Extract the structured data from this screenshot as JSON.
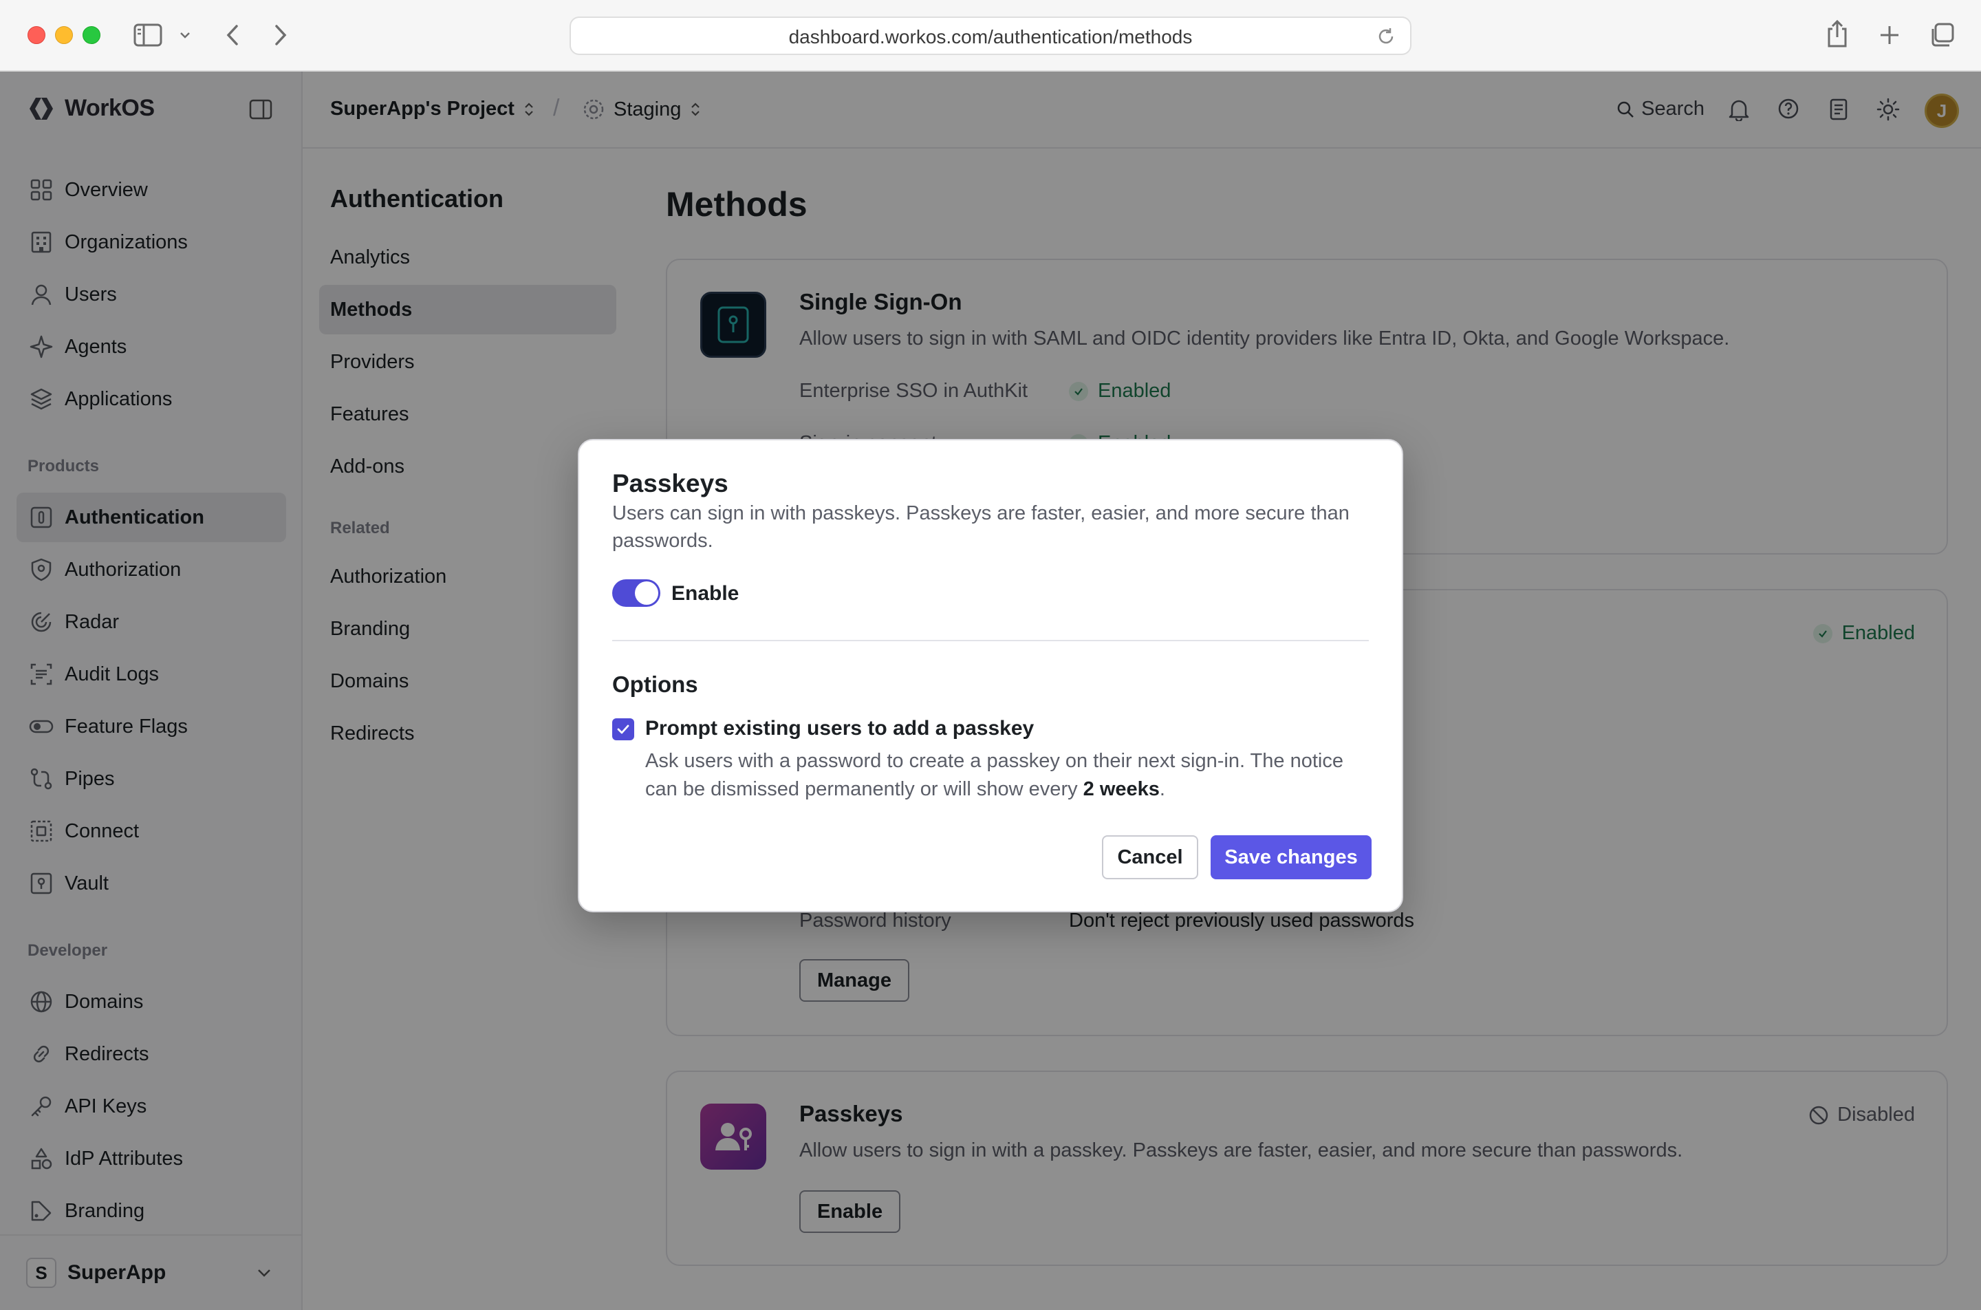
{
  "browser": {
    "url": "dashboard.workos.com/authentication/methods"
  },
  "sidebar": {
    "brand": "WorkOS",
    "items": [
      {
        "label": "Overview"
      },
      {
        "label": "Organizations"
      },
      {
        "label": "Users"
      },
      {
        "label": "Agents"
      },
      {
        "label": "Applications"
      }
    ],
    "products_label": "Products",
    "products": [
      {
        "label": "Authentication"
      },
      {
        "label": "Authorization"
      },
      {
        "label": "Radar"
      },
      {
        "label": "Audit Logs"
      },
      {
        "label": "Feature Flags"
      },
      {
        "label": "Pipes"
      },
      {
        "label": "Connect"
      },
      {
        "label": "Vault"
      }
    ],
    "developer_label": "Developer",
    "developer": [
      {
        "label": "Domains"
      },
      {
        "label": "Redirects"
      },
      {
        "label": "API Keys"
      },
      {
        "label": "IdP Attributes"
      },
      {
        "label": "Branding"
      }
    ],
    "workspace": {
      "initial": "S",
      "name": "SuperApp"
    }
  },
  "topbar": {
    "project": "SuperApp's Project",
    "separator": "/",
    "environment": "Staging",
    "search_label": "Search",
    "avatar_initial": "J"
  },
  "subnav": {
    "title": "Authentication",
    "items": [
      {
        "label": "Analytics"
      },
      {
        "label": "Methods"
      },
      {
        "label": "Providers"
      },
      {
        "label": "Features"
      },
      {
        "label": "Add-ons"
      }
    ],
    "related_label": "Related",
    "related": [
      {
        "label": "Authorization"
      },
      {
        "label": "Branding"
      },
      {
        "label": "Domains"
      },
      {
        "label": "Redirects"
      }
    ]
  },
  "main": {
    "title": "Methods",
    "sso": {
      "title": "Single Sign-On",
      "desc": "Allow users to sign in with SAML and OIDC identity providers like Entra ID, Okta, and Google Workspace.",
      "row1_label": "Enterprise SSO in AuthKit",
      "row1_value": "Enabled",
      "row2_label": "Sign-in consent",
      "row2_value": "Enabled"
    },
    "password": {
      "status": "Enabled",
      "history_label": "Password history",
      "history_value": "Don't reject previously used passwords",
      "manage_label": "Manage"
    },
    "passkeys": {
      "title": "Passkeys",
      "desc": "Allow users to sign in with a passkey. Passkeys are faster, easier, and more secure than passwords.",
      "status": "Disabled",
      "enable_label": "Enable"
    }
  },
  "modal": {
    "title": "Passkeys",
    "desc": "Users can sign in with passkeys. Passkeys are faster, easier, and more secure than passwords.",
    "toggle_label": "Enable",
    "toggle_on": true,
    "options_title": "Options",
    "checkbox_label": "Prompt existing users to add a passkey",
    "checkbox_checked": true,
    "help_prefix": "Ask users with a password to create a passkey on their next sign-in. The notice can be dismissed permanently or will show every ",
    "help_bold": "2 weeks",
    "help_suffix": ".",
    "cancel_label": "Cancel",
    "save_label": "Save changes"
  },
  "colors": {
    "accent": "#5b57e6",
    "enabled_green": "#1e7a4f"
  }
}
